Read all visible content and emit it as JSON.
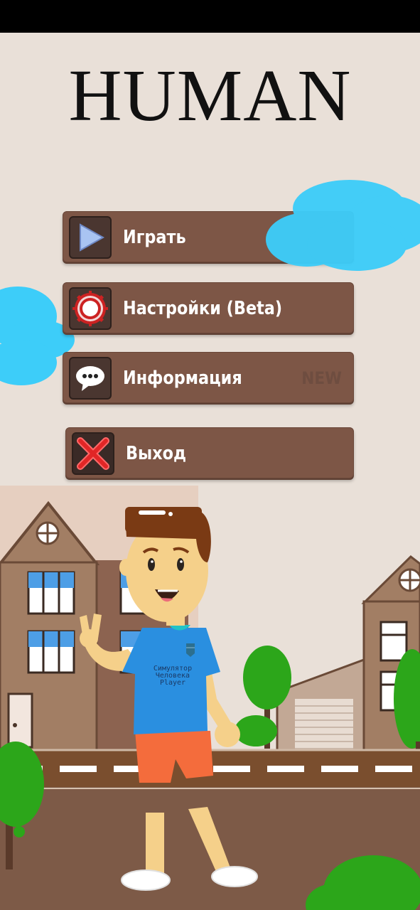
{
  "game": {
    "title": "HUMAN"
  },
  "menu": {
    "items": [
      {
        "label": "Играть",
        "icon": "play-icon"
      },
      {
        "label": "Настройки (Beta)",
        "icon": "gear-icon"
      },
      {
        "label": "Информация",
        "icon": "chat-bubble-icon",
        "badge": "NEW"
      },
      {
        "label": "Выход",
        "icon": "close-icon"
      }
    ]
  },
  "character": {
    "shirt_lines": [
      "Симулятор",
      "Человека",
      "Player"
    ]
  },
  "colors": {
    "background": "#e9e0d8",
    "button": "#7d5646",
    "cloud": "#3dcdf9",
    "shirt": "#2a8fe0",
    "shorts": "#f46c3c"
  }
}
